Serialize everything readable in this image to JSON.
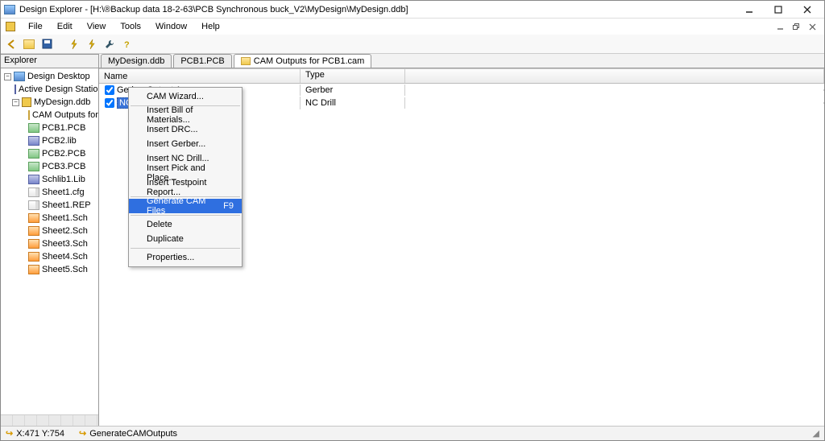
{
  "title": "Design Explorer - [H:\\®Backup data 18-2-63\\PCB Synchronous buck_V2\\MyDesign\\MyDesign.ddb]",
  "menu": {
    "file": "File",
    "edit": "Edit",
    "view": "View",
    "tools": "Tools",
    "window": "Window",
    "help": "Help"
  },
  "explorer": {
    "header": "Explorer"
  },
  "tree": {
    "root": "Design Desktop",
    "stations": "Active Design Stations",
    "project": "MyDesign.ddb",
    "items": [
      "CAM Outputs for PC",
      "PCB1.PCB",
      "PCB2.lib",
      "PCB2.PCB",
      "PCB3.PCB",
      "Schlib1.Lib",
      "Sheet1.cfg",
      "Sheet1.REP",
      "Sheet1.Sch",
      "Sheet2.Sch",
      "Sheet3.Sch",
      "Sheet4.Sch",
      "Sheet5.Sch"
    ]
  },
  "tabs": {
    "t1": "MyDesign.ddb",
    "t2": "PCB1.PCB",
    "t3": "CAM Outputs for PCB1.cam"
  },
  "list": {
    "col_name": "Name",
    "col_type": "Type",
    "rows": [
      {
        "name": "Gerber Output 1",
        "type": "Gerber"
      },
      {
        "name": "NC D",
        "type": "NC Drill"
      }
    ]
  },
  "context_menu": {
    "wizard": "CAM Wizard...",
    "bom": "Insert Bill of Materials...",
    "drc": "Insert DRC...",
    "gerber": "Insert Gerber...",
    "ncdrill": "Insert NC Drill...",
    "pick": "Insert Pick and Place...",
    "testpoint": "Insert Testpoint Report...",
    "generate": "Generate CAM Files",
    "generate_key": "F9",
    "delete": "Delete",
    "duplicate": "Duplicate",
    "properties": "Properties..."
  },
  "status": {
    "coords": "X:471 Y:754",
    "action": "GenerateCAMOutputs"
  }
}
